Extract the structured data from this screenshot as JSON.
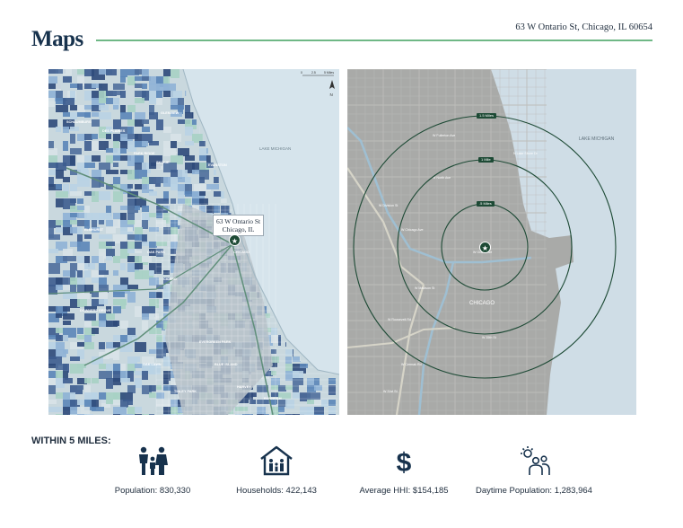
{
  "header": {
    "title": "Maps",
    "address": "63 W Ontario St, Chicago, IL 60654"
  },
  "left_map": {
    "callout_line1": "63 W Ontario St",
    "callout_line2": "Chicago, IL",
    "lake_label": "LAKE MICHIGAN",
    "north_label": "N",
    "scale_labels": [
      "0",
      "2.5",
      "5 Miles"
    ],
    "place_labels": [
      "EVANSTON",
      "SKOKIE",
      "CHICAGO",
      "CICERO",
      "OAK PARK",
      "EVERGREEN PARK",
      "HARVEY",
      "TINLEY PARK",
      "ELMHURST",
      "DOWNERS GROVE",
      "SCHAUMBURG",
      "DES PLAINES",
      "PARK RIDGE",
      "OAK LAWN",
      "BLUE ISLAND",
      "GLENVIEW",
      "BURNHAM"
    ]
  },
  "right_map": {
    "lake_label": "LAKE MICHIGAN",
    "city_label": "CHICAGO",
    "ring_labels": [
      "1.5 Miles",
      "1 Mile",
      ".5 Miles"
    ],
    "street_labels": [
      "W Fullerton Ave",
      "W North Ave",
      "W Division St",
      "W Chicago Ave",
      "W Grand Ave",
      "W Madison St",
      "W Roosevelt Rd",
      "W Cermak Rd",
      "W 31st St",
      "W 35th St",
      "N Lake Shore Dr"
    ]
  },
  "stats": {
    "heading": "WITHIN 5 MILES:",
    "items": [
      {
        "icon": "family-icon",
        "label": "Population: 830,330"
      },
      {
        "icon": "house-people-icon",
        "label": "Households: 422,143"
      },
      {
        "icon": "dollar-icon",
        "label": "Average HHI: $154,185"
      },
      {
        "icon": "daytime-people-icon",
        "label": "Daytime Population: 1,283,964"
      }
    ]
  },
  "colors": {
    "accent": "#6fb886",
    "title": "#17324d",
    "marker": "#1d4a35",
    "water": "#cfdde6"
  }
}
